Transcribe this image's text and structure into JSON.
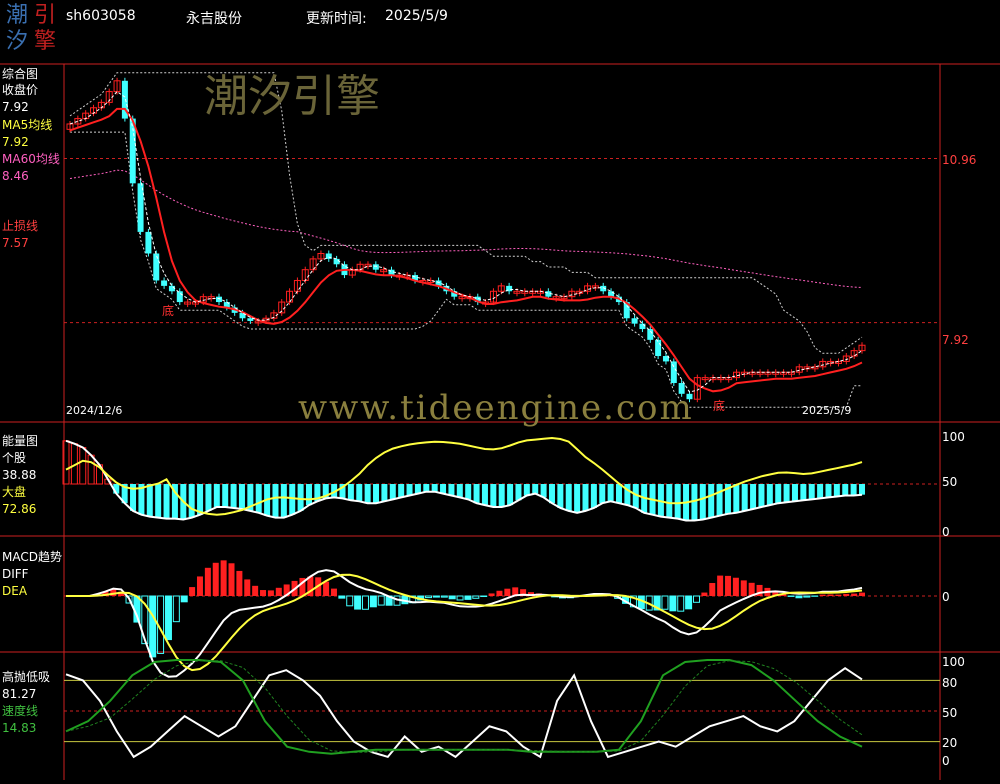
{
  "header": {
    "code": "sh603058",
    "name": "永吉股份",
    "update_label": "更新时间:",
    "update_date": "2025/5/9"
  },
  "logo": {
    "chars": [
      "潮",
      "引",
      "汐",
      "擎"
    ]
  },
  "watermarks": {
    "cn": "潮汐引擎",
    "url": "www.tideengine.com"
  },
  "panels": {
    "main": {
      "title": "综合图",
      "close_label": "收盘价",
      "close_value": "7.92",
      "ma5_label": "MA5均线",
      "ma5_value": "7.92",
      "ma60_label": "MA60均线",
      "ma60_value": "8.46",
      "stop_label": "止损线",
      "stop_value": "7.57",
      "right_ticks": [
        "10.96",
        "7.92"
      ],
      "date_start": "2024/12/6",
      "date_end": "2025/5/9",
      "bottom_marks": [
        "底",
        "底"
      ]
    },
    "energy": {
      "title": "能量图",
      "stock_label": "个股",
      "stock_value": "38.88",
      "market_label": "大盘",
      "market_value": "72.86",
      "right_ticks": [
        "100",
        "50",
        "0"
      ]
    },
    "macd": {
      "title": "MACD趋势",
      "diff_label": "DIFF",
      "dea_label": "DEA",
      "right_ticks": [
        "0"
      ]
    },
    "hilo": {
      "title": "高抛低吸",
      "value": "81.27",
      "speed_label": "速度线",
      "speed_value": "14.83",
      "right_ticks": [
        "100",
        "80",
        "50",
        "20",
        "0"
      ]
    }
  },
  "colors": {
    "frame": "#cc2020",
    "up": "#ff2020",
    "down": "#40ffff",
    "yellow": "#ffff40",
    "white": "#ffffff",
    "green": "#20a020",
    "ma60": "#ff60c0",
    "grey_label": "#c0c0c0"
  },
  "chart_data": {
    "type": "candlestick",
    "date_range": [
      "2024/12/6",
      "2025/5/9"
    ],
    "price_axis": {
      "labels": [
        10.96,
        7.92
      ]
    },
    "close_last": 7.92,
    "ma5_last": 7.92,
    "ma60_last": 8.46,
    "stop_loss_last": 7.57,
    "close": [
      11.6,
      11.7,
      11.8,
      11.9,
      12.0,
      12.2,
      12.4,
      11.7,
      10.5,
      9.6,
      9.2,
      8.7,
      8.6,
      8.5,
      8.3,
      8.3,
      8.3,
      8.4,
      8.4,
      8.3,
      8.2,
      8.1,
      8.0,
      7.95,
      7.95,
      8.0,
      8.1,
      8.3,
      8.5,
      8.7,
      8.9,
      9.1,
      9.2,
      9.1,
      9.0,
      8.8,
      8.9,
      9.0,
      9.0,
      8.9,
      8.9,
      8.8,
      8.8,
      8.8,
      8.7,
      8.7,
      8.7,
      8.6,
      8.5,
      8.4,
      8.4,
      8.4,
      8.3,
      8.3,
      8.5,
      8.6,
      8.5,
      8.5,
      8.5,
      8.5,
      8.5,
      8.4,
      8.4,
      8.4,
      8.5,
      8.5,
      8.6,
      8.6,
      8.5,
      8.4,
      8.3,
      8.0,
      7.9,
      7.8,
      7.6,
      7.3,
      7.2,
      6.8,
      6.6,
      6.5,
      6.9,
      6.9,
      6.9,
      6.9,
      6.9,
      7.0,
      7.0,
      7.0,
      7.0,
      7.0,
      7.0,
      7.0,
      7.0,
      7.1,
      7.1,
      7.1,
      7.2,
      7.2,
      7.2,
      7.3,
      7.4,
      7.5
    ],
    "energy_stock_last": 38.88,
    "energy_market_last": 72.86,
    "energy_axis": [
      0,
      50,
      100
    ],
    "energy_stock": [
      95,
      92,
      88,
      80,
      70,
      55,
      40,
      30,
      22,
      18,
      16,
      15,
      14,
      14,
      13,
      15,
      18,
      22,
      26,
      26,
      25,
      24,
      22,
      20,
      17,
      15,
      15,
      18,
      22,
      28,
      32,
      35,
      36,
      35,
      33,
      32,
      30,
      30,
      32,
      34,
      36,
      38,
      40,
      42,
      42,
      40,
      38,
      36,
      34,
      30,
      28,
      26,
      26,
      28,
      33,
      38,
      40,
      36,
      30,
      25,
      22,
      20,
      22,
      25,
      30,
      32,
      30,
      28,
      25,
      20,
      18,
      16,
      15,
      14,
      12,
      12,
      13,
      15,
      17,
      19,
      20,
      22,
      24,
      26,
      28,
      30,
      31,
      32,
      33,
      34,
      35,
      36,
      37,
      38,
      38,
      38.88
    ],
    "energy_market": [
      65,
      70,
      75,
      72,
      65,
      55,
      48,
      45,
      45,
      48,
      50,
      55,
      40,
      30,
      22,
      20,
      18,
      18,
      20,
      22,
      26,
      30,
      34,
      36,
      36,
      35,
      34,
      34,
      36,
      40,
      45,
      52,
      60,
      70,
      78,
      84,
      88,
      90,
      92,
      93,
      94,
      94,
      93,
      92,
      90,
      88,
      86,
      86,
      88,
      92,
      95,
      96,
      97,
      98,
      97,
      94,
      85,
      76,
      70,
      62,
      54,
      46,
      40,
      36,
      34,
      32,
      30,
      30,
      31,
      33,
      36,
      40,
      44,
      48,
      52,
      55,
      58,
      60,
      62,
      62,
      61,
      60,
      62,
      64,
      66,
      68,
      70,
      72.86
    ],
    "macd_diff_last": null,
    "hilo_last": 81.27,
    "hilo_speed_last": 14.83,
    "hilo_axis": [
      0,
      20,
      50,
      80,
      100
    ]
  }
}
